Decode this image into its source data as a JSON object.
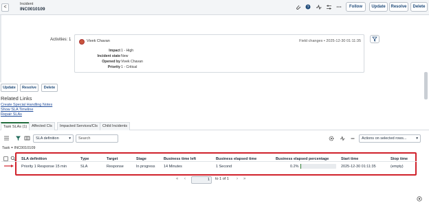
{
  "header": {
    "record_type": "Incident",
    "record_number": "INC0010109",
    "back_glyph": "<",
    "buttons": [
      "Follow",
      "Update",
      "Resolve",
      "Delete"
    ]
  },
  "activity": {
    "label": "Activities: 1",
    "user": "Vivek Chavan",
    "meta": "Field changes • 2025-12-30 01:11:35",
    "fields": [
      {
        "k": "Impact",
        "v": "1 - High"
      },
      {
        "k": "Incident state",
        "v": "New"
      },
      {
        "k": "Opened by",
        "v": "Vivek Chavan"
      },
      {
        "k": "Priority",
        "v": "1 - Critical"
      }
    ]
  },
  "form_buttons": [
    "Update",
    "Resolve",
    "Delete"
  ],
  "related_links": {
    "title": "Related Links",
    "links": [
      "Create Special Handling Notes",
      "Show SLA Timeline",
      "Repair SLAs"
    ]
  },
  "tabs": [
    "Task SLAs (1)",
    "Affected CIs",
    "Impacted Services/CIs",
    "Child Incidents"
  ],
  "list": {
    "filter_field": "SLA definition",
    "search_placeholder": "Search",
    "actions_label": "Actions on selected rows...",
    "breadcrumb": "Task = INC0010109",
    "columns": [
      "SLA definition",
      "Type",
      "Target",
      "Stage",
      "Business time left",
      "Business elapsed time",
      "Business elapsed percentage",
      "Start time",
      "Stop time"
    ],
    "rows": [
      [
        "Priority 1 Response 15 min",
        "SLA",
        "Response",
        "In progress",
        "14 Minutes",
        "1 Second",
        "0.2%",
        "2025-12-30 01:11:35",
        "(empty)"
      ]
    ],
    "progress_fraction": 0.002,
    "pager": {
      "page": "1",
      "of_text": "to 1 of 1"
    }
  },
  "colors": {
    "highlight": "#d0202a",
    "link": "#1f4b9a",
    "active_tab": "#1f6b3a"
  }
}
